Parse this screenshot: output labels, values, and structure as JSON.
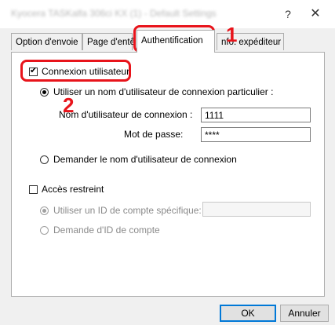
{
  "window": {
    "title": "Kyocera TASKalfa 306ci KX (1) - Default Settings",
    "help_glyph": "?",
    "close_glyph": "✕"
  },
  "tabs": [
    {
      "label": "Option d'envoie"
    },
    {
      "label": "Page d'entê"
    },
    {
      "label": "Authentification",
      "active": true
    },
    {
      "label": "nfo. expéditeur"
    }
  ],
  "auth": {
    "user_login": {
      "label": "Connexion utilisateur",
      "checked": true
    },
    "specific_login": {
      "label": "Utiliser un nom d'utilisateur de connexion particulier :",
      "selected": true
    },
    "username": {
      "label": "Nom d'utilisateur de connexion :",
      "value": "1111"
    },
    "password": {
      "label": "Mot de passe:",
      "value": "****"
    },
    "ask_login": {
      "label": "Demander le nom d'utilisateur de connexion",
      "selected": false
    }
  },
  "restricted": {
    "access": {
      "label": "Accès restreint",
      "checked": false
    },
    "specific_id": {
      "label": "Utiliser un ID de compte spécifique:",
      "selected": true,
      "enabled": false,
      "value": ""
    },
    "ask_id": {
      "label": "Demande d'ID de compte",
      "selected": false,
      "enabled": false
    }
  },
  "annotations": {
    "step1": "1",
    "step2": "2",
    "color": "#e8141b"
  },
  "buttons": {
    "ok": "OK",
    "cancel": "Annuler"
  }
}
